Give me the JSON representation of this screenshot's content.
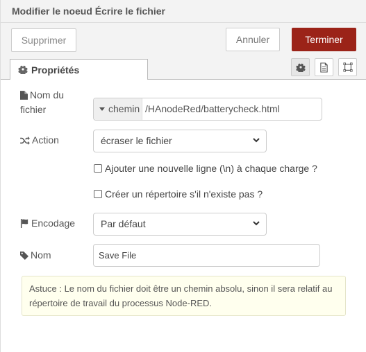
{
  "header": {
    "title": "Modifier le noeud Écrire le fichier"
  },
  "toolbar": {
    "delete_label": "Supprimer",
    "cancel_label": "Annuler",
    "done_label": "Terminer"
  },
  "tabs": [
    {
      "label": "Propriétés",
      "icon": "gear-icon"
    }
  ],
  "tab_buttons": [
    "gear-icon",
    "description-icon",
    "appearance-icon"
  ],
  "form": {
    "filename": {
      "label_line1": "Nom du",
      "label_line2": "fichier",
      "type": "chemin",
      "value": "/HAnodeRed/batterycheck.html"
    },
    "action": {
      "label": "Action",
      "value": "écraser le fichier"
    },
    "append_newline": {
      "label": "Ajouter une nouvelle ligne (\\n) à chaque charge ?",
      "checked": false
    },
    "create_dir": {
      "label": "Créer un répertoire s'il n'existe pas ?",
      "checked": false
    },
    "encoding": {
      "label": "Encodage",
      "value": "Par défaut"
    },
    "name": {
      "label": "Nom",
      "value": "Save File"
    }
  },
  "tip": "Astuce : Le nom du fichier doit être un chemin absolu, sinon il sera relatif au répertoire de travail du processus Node-RED.",
  "colors": {
    "primary": "#9b2318",
    "tip_bg": "#ffffee"
  }
}
